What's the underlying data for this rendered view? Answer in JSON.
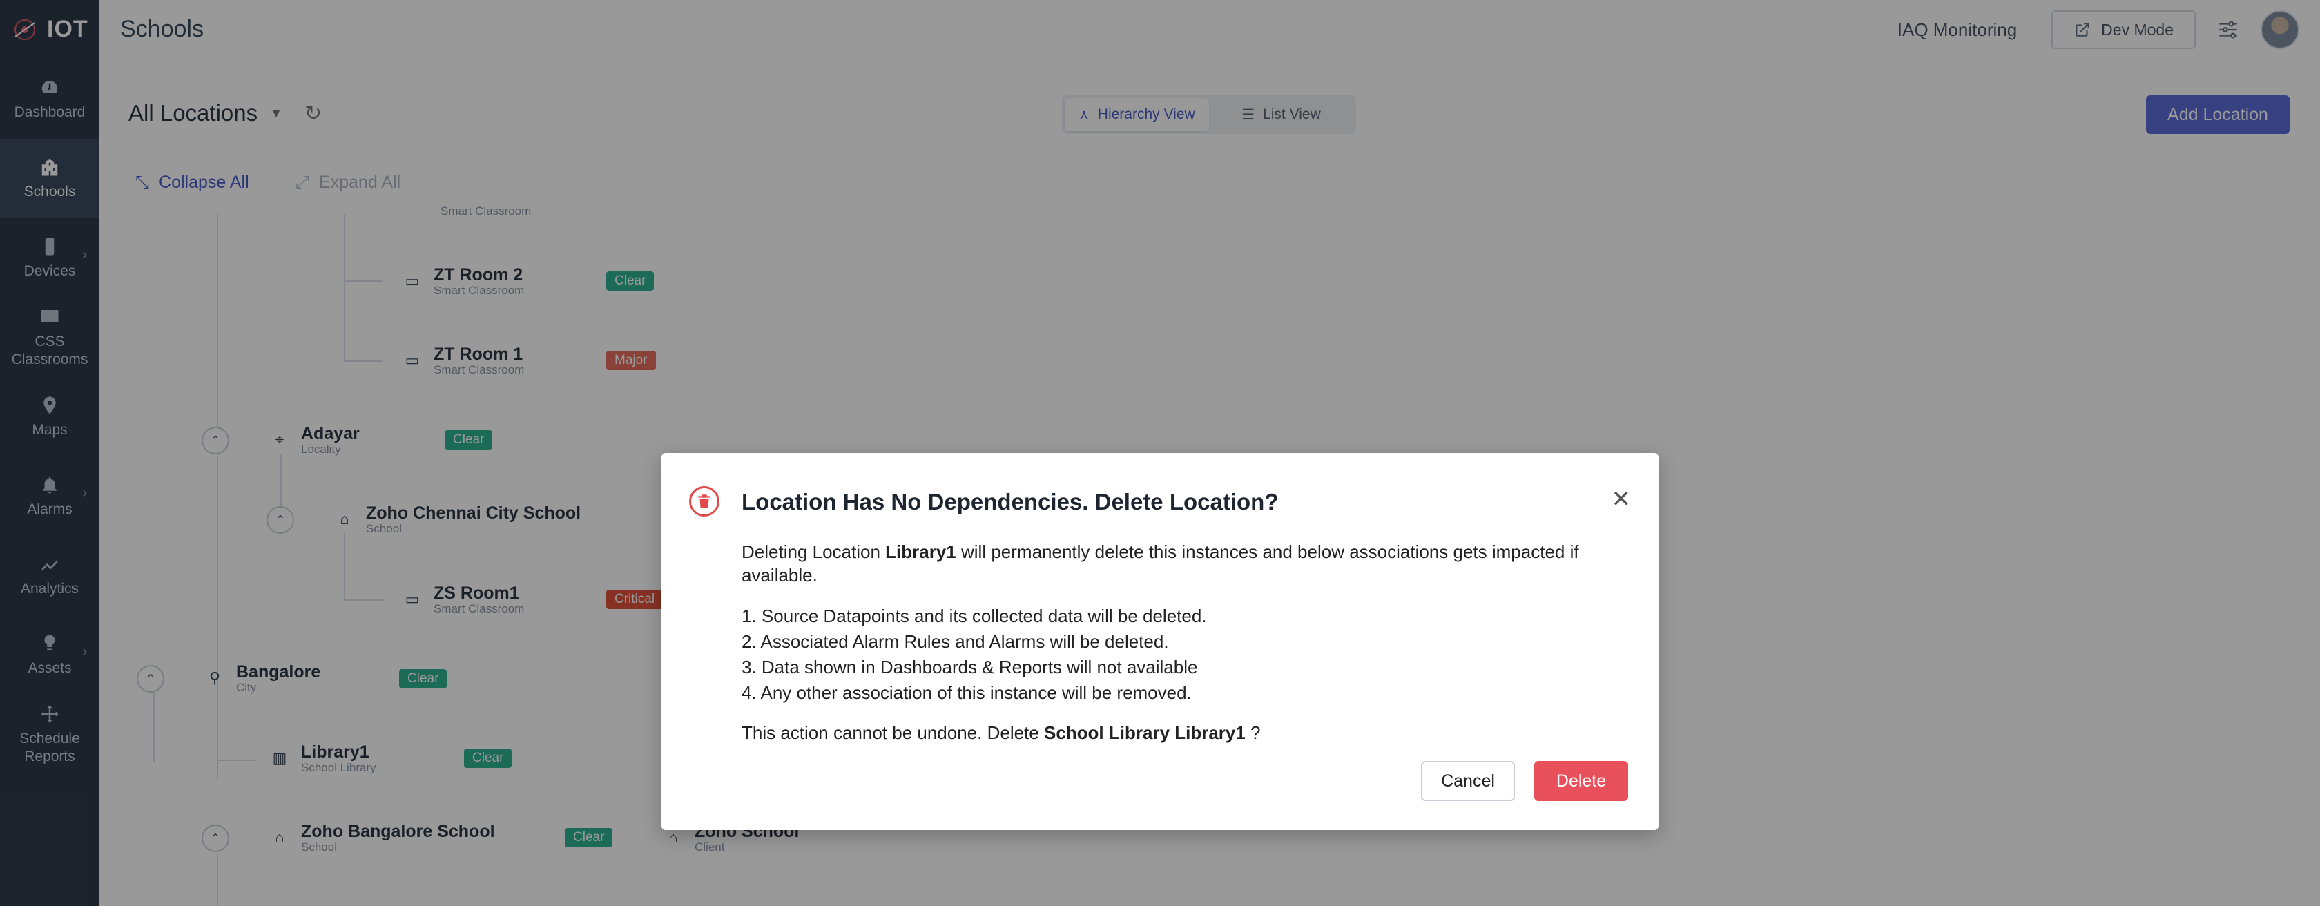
{
  "app": {
    "brand": "IOT",
    "page_title": "Schools",
    "app_name": "IAQ Monitoring",
    "dev_mode": "Dev Mode"
  },
  "sidebar": {
    "items": [
      {
        "label": "Dashboard",
        "icon": "dashboard-icon",
        "active": false
      },
      {
        "label": "Schools",
        "icon": "schools-icon",
        "active": true
      },
      {
        "label": "Devices",
        "icon": "devices-icon",
        "active": false
      },
      {
        "label": "CSS Classrooms",
        "icon": "classroom-icon",
        "active": false
      },
      {
        "label": "Maps",
        "icon": "map-pin-icon",
        "active": false
      },
      {
        "label": "Alarms",
        "icon": "bell-icon",
        "active": false
      },
      {
        "label": "Analytics",
        "icon": "analytics-icon",
        "active": false
      },
      {
        "label": "Assets",
        "icon": "assets-icon",
        "active": false
      },
      {
        "label": "Schedule Reports",
        "icon": "schedule-icon",
        "active": false
      }
    ]
  },
  "toolbar": {
    "location_filter": "All Locations",
    "view_hierarchy": "Hierarchy View",
    "view_list": "List View",
    "add_location": "Add Location",
    "collapse_all": "Collapse All",
    "expand_all": "Expand All"
  },
  "tree": {
    "partial_top": "Smart Classroom",
    "room2": {
      "title": "ZT Room 2",
      "sub": "Smart Classroom",
      "status": "Clear"
    },
    "room1": {
      "title": "ZT Room 1",
      "sub": "Smart Classroom",
      "status": "Major"
    },
    "adayar": {
      "title": "Adayar",
      "sub": "Locality",
      "status": "Clear"
    },
    "chennai_school": {
      "title": "Zoho Chennai City School",
      "sub": "School"
    },
    "zs_room1": {
      "title": "ZS Room1",
      "sub": "Smart Classroom",
      "status": "Critical"
    },
    "bangalore": {
      "title": "Bangalore",
      "sub": "City",
      "status": "Clear"
    },
    "library1": {
      "title": "Library1",
      "sub": "School Library",
      "status": "Clear"
    },
    "blr_school": {
      "title": "Zoho Bangalore School",
      "sub": "School",
      "status": "Clear"
    },
    "zoho_school": {
      "title": "Zoho School",
      "sub": "Client"
    }
  },
  "modal": {
    "title": "Location Has No Dependencies. Delete Location?",
    "intro_prefix": "Deleting Location",
    "intro_name": "Library1",
    "intro_suffix": "will permanently delete this instances and below associations gets impacted if available.",
    "items": [
      "1. Source Datapoints and its collected data will be deleted.",
      "2. Associated Alarm Rules and Alarms will be deleted.",
      "3. Data shown in Dashboards & Reports will not available",
      "4. Any other association of this instance will be removed."
    ],
    "final_prefix": "This action cannot be undone. Delete",
    "final_name": "School Library Library1",
    "final_suffix": "?",
    "cancel": "Cancel",
    "delete": "Delete"
  },
  "colors": {
    "sidebar_bg": "#2f3a4a",
    "accent": "#5c6bd8",
    "clear": "#2fb38f",
    "major": "#e66d5c",
    "critical": "#e2523f",
    "danger": "#e8505b"
  }
}
